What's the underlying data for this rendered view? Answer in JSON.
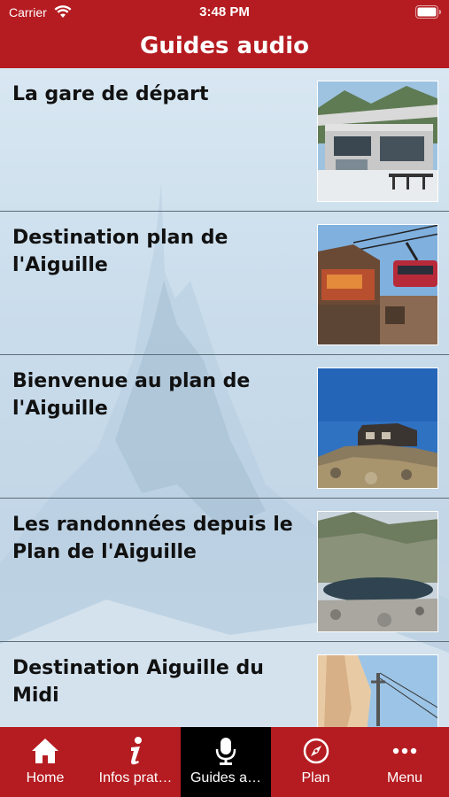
{
  "status_bar": {
    "carrier": "Carrier",
    "time": "3:48 PM"
  },
  "nav": {
    "title": "Guides audio"
  },
  "guides": [
    {
      "title": "La gare de départ",
      "image": "station-building-photo"
    },
    {
      "title": "Destination plan de l'Aiguille",
      "image": "cable-car-station-photo"
    },
    {
      "title": "Bienvenue au plan de l'Aiguille",
      "image": "mountain-hut-photo"
    },
    {
      "title": "Les randonnées depuis le Plan de l'Aiguille",
      "image": "mountain-lake-photo"
    },
    {
      "title": "Destination Aiguille du Midi",
      "image": "rock-face-pylon-photo"
    }
  ],
  "tabs": [
    {
      "label": "Home",
      "icon": "home-icon",
      "active": false
    },
    {
      "label": "Infos prat…",
      "icon": "info-icon",
      "active": false
    },
    {
      "label": "Guides a…",
      "icon": "microphone-icon",
      "active": true
    },
    {
      "label": "Plan",
      "icon": "compass-icon",
      "active": false
    },
    {
      "label": "Menu",
      "icon": "more-dots-icon",
      "active": false
    }
  ],
  "colors": {
    "brand_red": "#b51c21",
    "active_tab": "#000000",
    "text": "#111111"
  }
}
